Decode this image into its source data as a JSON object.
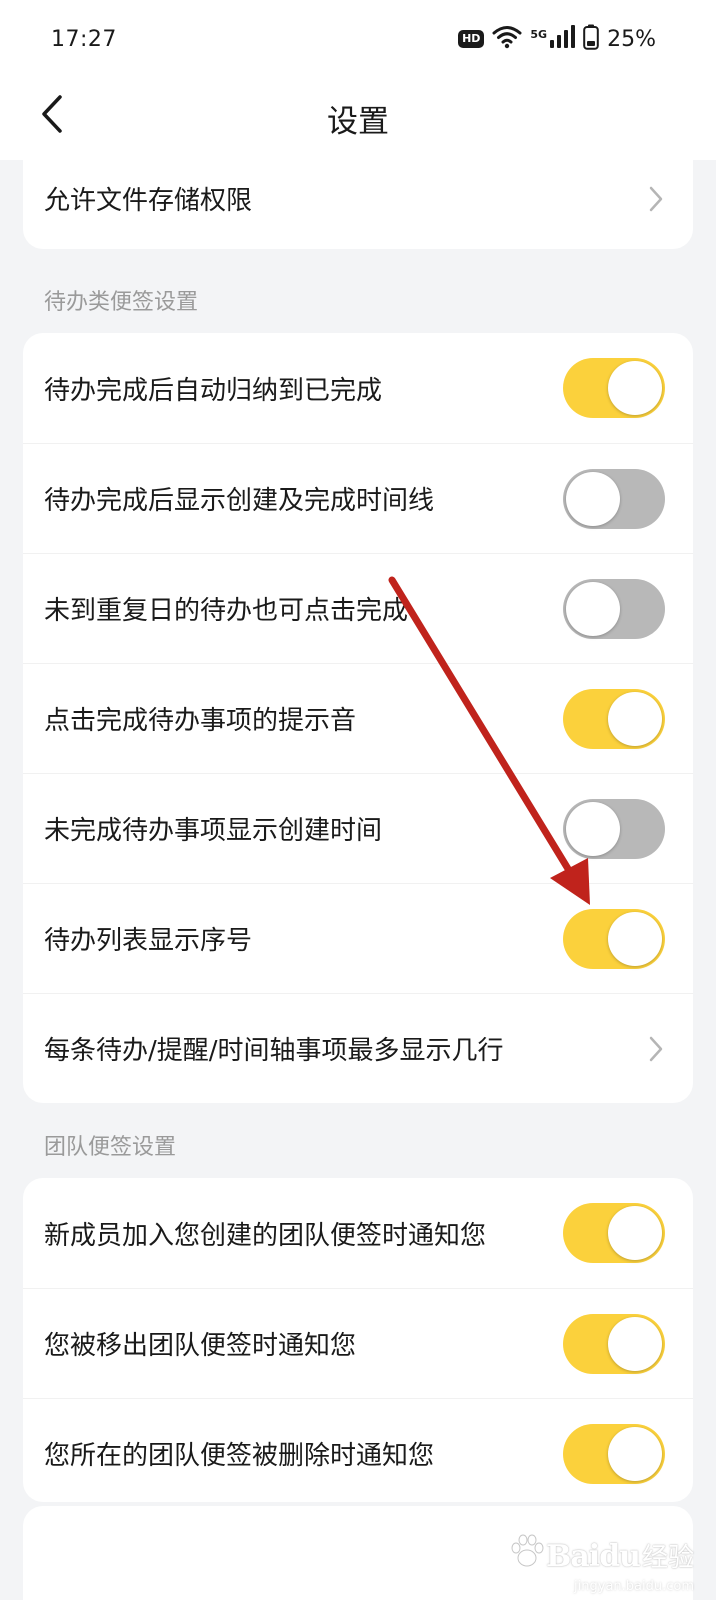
{
  "status_bar": {
    "time": "17:27",
    "hd_badge": "HD",
    "network_label": "5G",
    "battery_percent": "25%"
  },
  "header": {
    "title": "设置",
    "back_icon": "chevron-left-icon"
  },
  "storage_card": {
    "label": "允许文件存储权限"
  },
  "todo_section": {
    "title": "待办类便签设置",
    "rows": [
      {
        "label": "待办完成后自动归纳到已完成",
        "toggle": true
      },
      {
        "label": "待办完成后显示创建及完成时间线",
        "toggle": false
      },
      {
        "label": "未到重复日的待办也可点击完成",
        "toggle": false
      },
      {
        "label": "点击完成待办事项的提示音",
        "toggle": true
      },
      {
        "label": "未完成待办事项显示创建时间",
        "toggle": false
      },
      {
        "label": "待办列表显示序号",
        "toggle": true
      }
    ],
    "lines_row_label": "每条待办/提醒/时间轴事项最多显示几行"
  },
  "team_section": {
    "title": "团队便签设置",
    "rows": [
      {
        "label": "新成员加入您创建的团队便签时通知您",
        "toggle": true
      },
      {
        "label": "您被移出团队便签时通知您",
        "toggle": true
      },
      {
        "label": "您所在的团队便签被删除时通知您",
        "toggle": true
      }
    ]
  },
  "watermark": {
    "brand": "Baidu",
    "text": "经验",
    "sub": "jingyan.baidu.com"
  },
  "colors": {
    "toggle_on": "#fbd13c",
    "toggle_off": "#b8b8b8",
    "background": "#f3f4f6",
    "annotation_arrow": "#c0231c"
  }
}
